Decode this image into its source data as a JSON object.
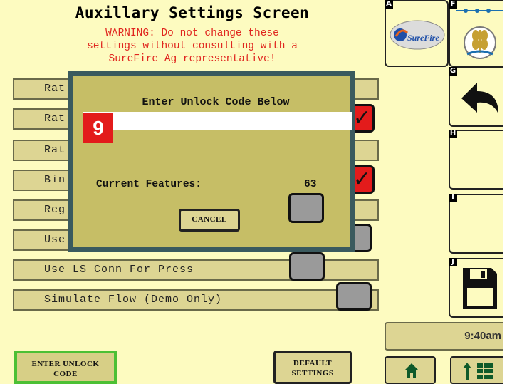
{
  "screen": {
    "title": "Auxillary Settings Screen",
    "warning_lines": [
      "WARNING: Do not change these",
      "settings without consulting with a",
      "SureFire Ag representative!"
    ]
  },
  "settings_rows": [
    {
      "label": "Rat",
      "checked": false
    },
    {
      "label": "Rat",
      "checked": true
    },
    {
      "label": "Rat",
      "checked": false
    },
    {
      "label": "Bin",
      "checked": true
    },
    {
      "label": "Reg",
      "checked": false
    },
    {
      "label": "Use",
      "checked": false
    },
    {
      "label": "Use LS Conn For Press",
      "checked": false
    },
    {
      "label": "Simulate Flow (Demo Only)",
      "checked": false
    }
  ],
  "dialog": {
    "heading": "Enter Unlock Code Below",
    "code_value": "",
    "badge": "9",
    "features_label": "Current Features:",
    "features_value": "63",
    "cancel_label": "CANCEL"
  },
  "softkeys": {
    "a": {
      "letter": "A",
      "icon": "surefire-logo-icon",
      "logo_text": "SureFire"
    },
    "f": {
      "letter": "F",
      "icon": "seed-crop-icon"
    },
    "g": {
      "letter": "G",
      "icon": "back-arrow-icon"
    },
    "h": {
      "letter": "H"
    },
    "i": {
      "letter": "I"
    },
    "j": {
      "letter": "J",
      "icon": "save-disk-icon"
    }
  },
  "status": {
    "time": "9:40am"
  },
  "bottom": {
    "unlock_label_1": "ENTER UNLOCK",
    "unlock_label_2": "CODE",
    "default_label_1": "DEFAULT",
    "default_label_2": "SETTINGS",
    "home_icon": "home-icon",
    "menu_icon": "menu-grid-icon"
  },
  "colors": {
    "background": "#fdfbc0",
    "warning": "#e0261f",
    "dialog": "#c6be66",
    "dialog_border": "#3a5a5e",
    "checked": "#e31b1b",
    "unlock_border": "#4cc034"
  }
}
